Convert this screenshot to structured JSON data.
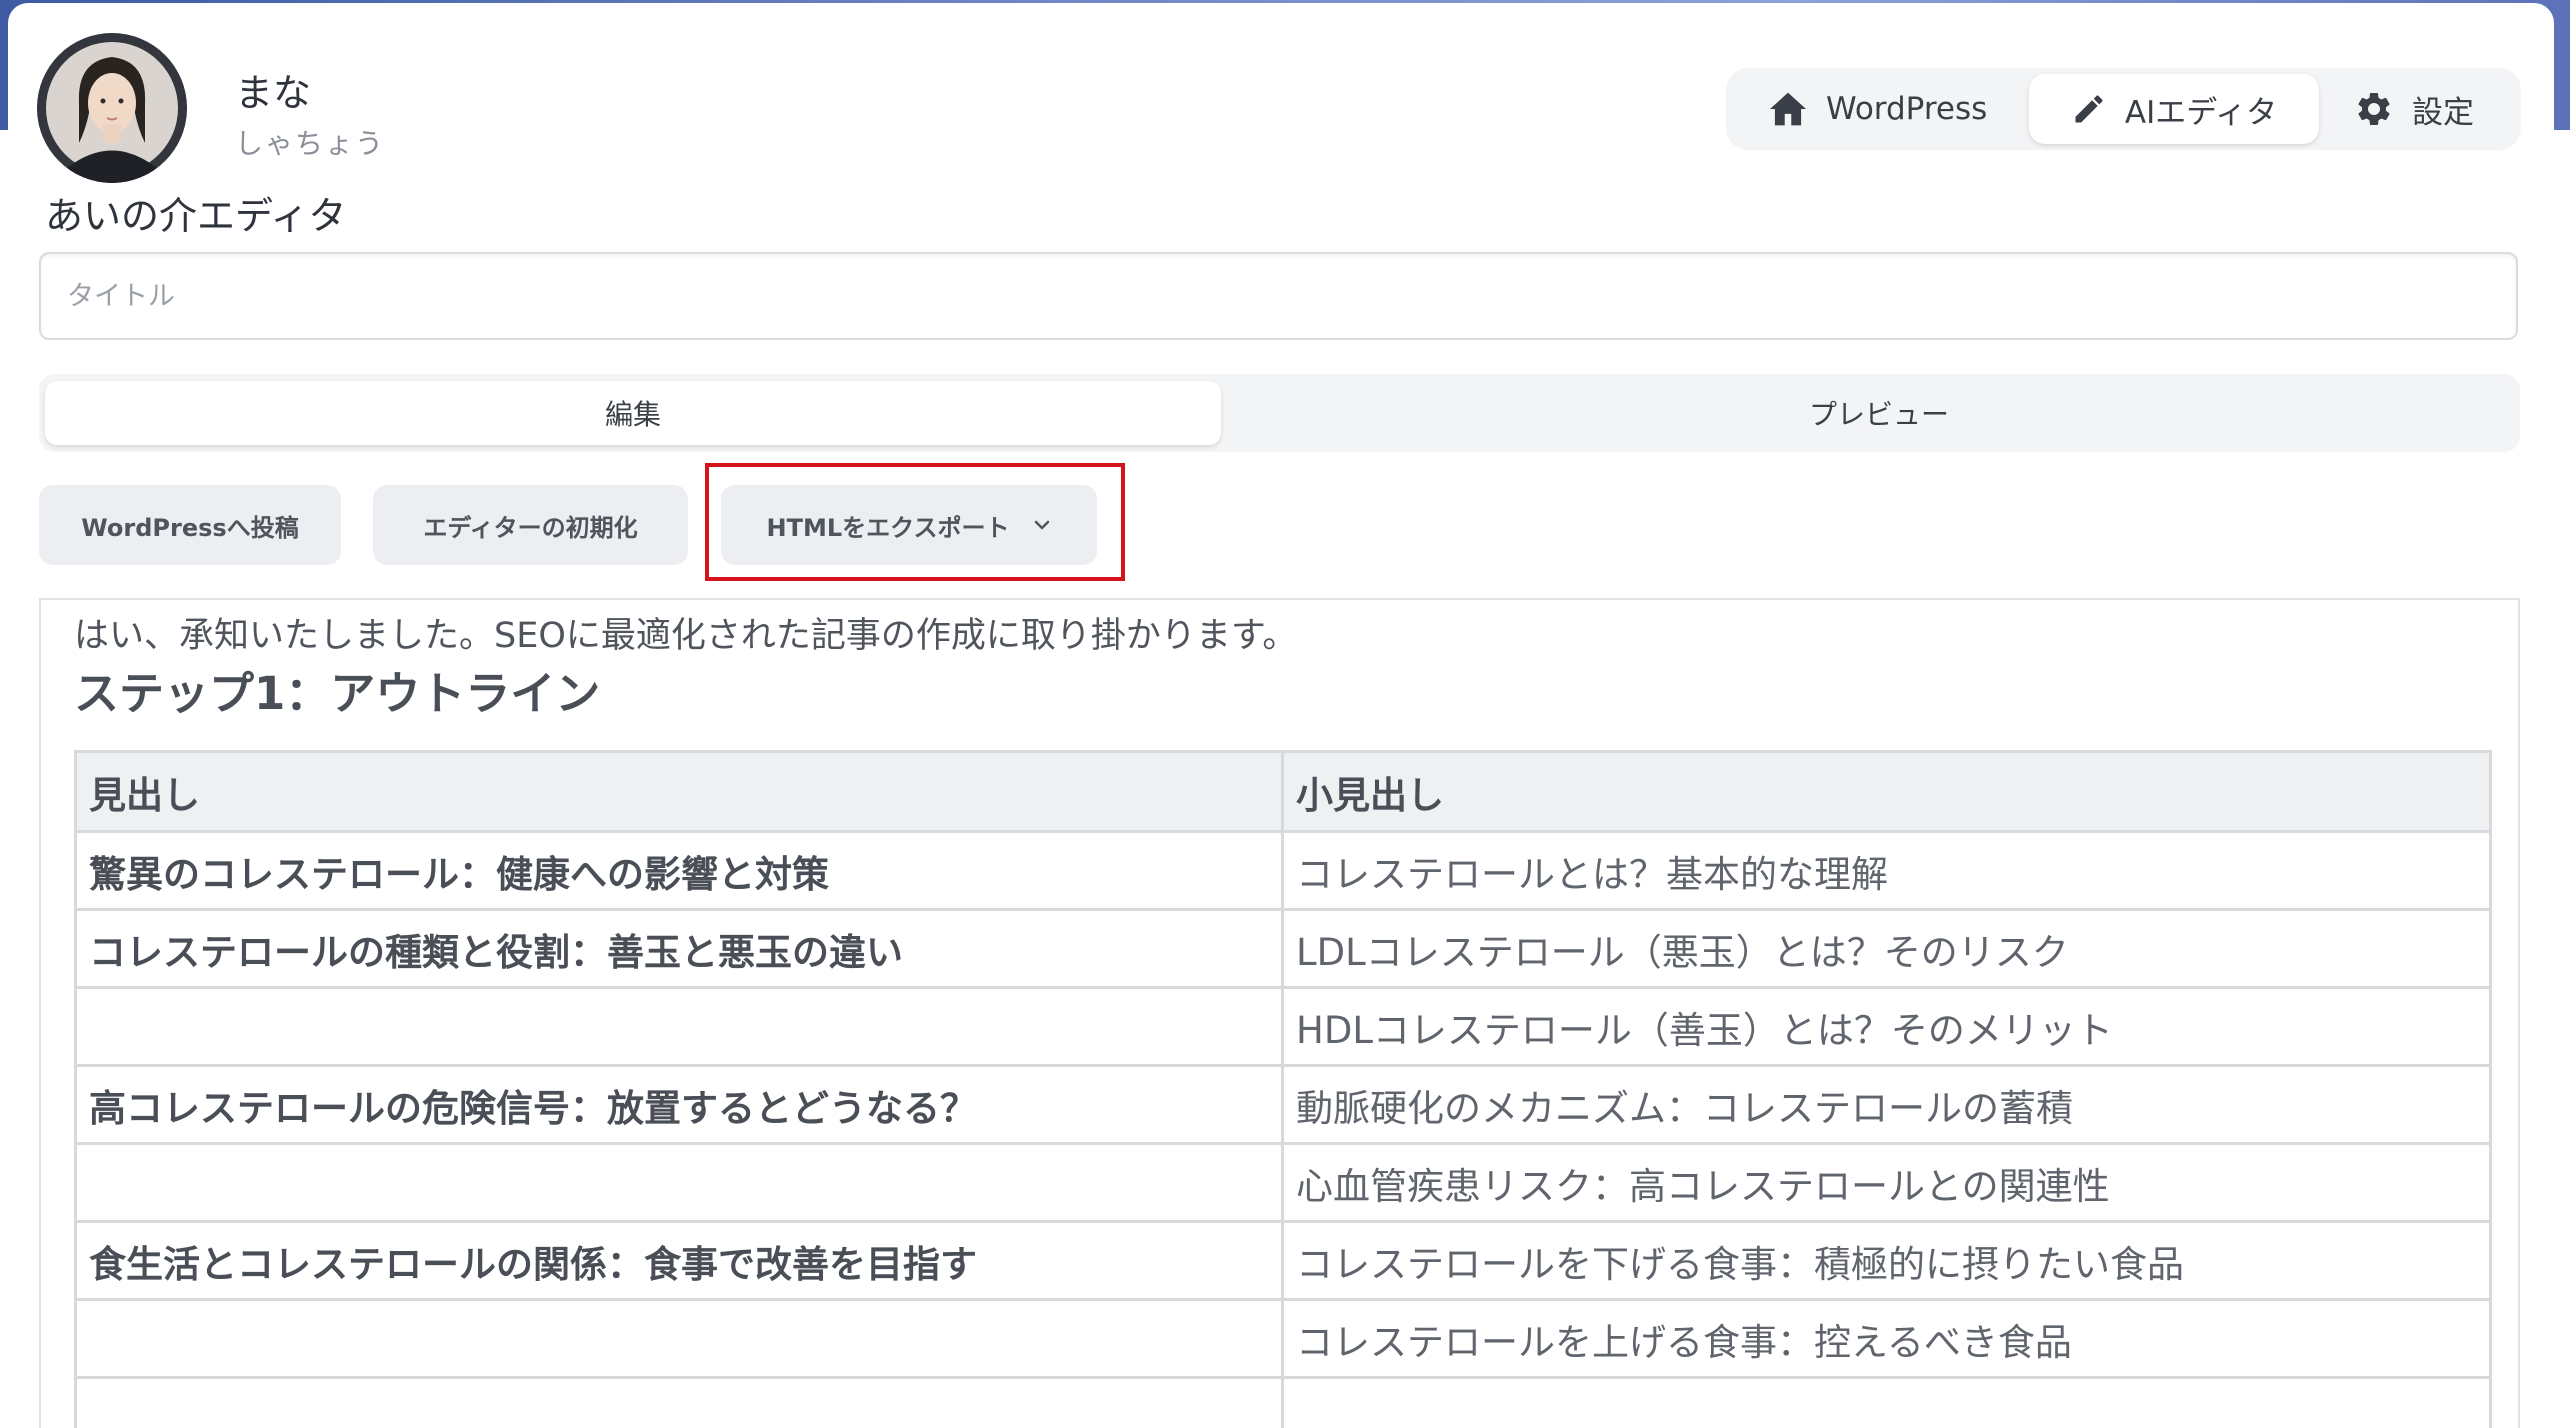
{
  "profile": {
    "name": "まな",
    "subtitle": "しゃちょう"
  },
  "app_title": "あいの介エディタ",
  "nav": {
    "items": [
      {
        "label": "WordPress",
        "icon": "home-icon"
      },
      {
        "label": "AIエディタ",
        "icon": "pencil-icon"
      },
      {
        "label": "設定",
        "icon": "gear-icon"
      }
    ],
    "active": "AIエディタ"
  },
  "title_field": {
    "placeholder": "タイトル",
    "value": ""
  },
  "tabs": {
    "edit": "編集",
    "preview": "プレビュー",
    "active": "編集"
  },
  "actions": {
    "post_to_wordpress": "WordPressへ投稿",
    "reset_editor": "エディターの初期化",
    "export_html": "HTMLをエクスポート"
  },
  "content": {
    "intro": "はい、承知いたしました。SEOに最適化された記事の作成に取り掛かります。",
    "heading": "ステップ1：アウトライン",
    "table": {
      "headers": [
        "見出し",
        "小見出し"
      ],
      "rows": [
        [
          "驚異のコレステロール：健康への影響と対策",
          "コレステロールとは？基本的な理解"
        ],
        [
          "コレステロールの種類と役割：善玉と悪玉の違い",
          "LDLコレステロール（悪玉）とは？そのリスク"
        ],
        [
          "",
          "HDLコレステロール（善玉）とは？そのメリット"
        ],
        [
          "高コレステロールの危険信号：放置するとどうなる？",
          "動脈硬化のメカニズム：コレステロールの蓄積"
        ],
        [
          "",
          "心血管疾患リスク：高コレステロールとの関連性"
        ],
        [
          "食生活とコレステロールの関係：食事で改善を目指す",
          "コレステロールを下げる食事：積極的に摂りたい食品"
        ],
        [
          "",
          "コレステロールを上げる食事：控えるべき食品"
        ]
      ]
    }
  },
  "colors": {
    "highlight_border": "#d4131b",
    "nav_background": "#f3f4f6",
    "button_background": "#eceef1"
  }
}
